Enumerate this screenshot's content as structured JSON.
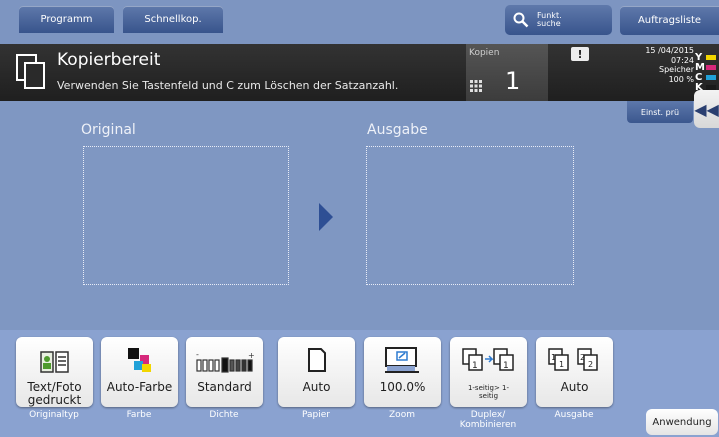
{
  "header": {
    "tab_programm": "Programm",
    "tab_schnellkop": "Schnellkop.",
    "funkt_suche_line1": "Funkt.",
    "funkt_suche_line2": "suche",
    "auftragsliste": "Auftragsliste"
  },
  "status": {
    "title": "Kopierbereit",
    "message": "Verwenden Sie Tastenfeld und C zum Löschen der Satzanzahl.",
    "copies_label": "Kopien",
    "copies_value": "1",
    "warning_symbol": "!",
    "date": "15 /04/2015",
    "time": "07:24",
    "memory_label": "Speicher",
    "memory_value": "100 %",
    "toner_levels": [
      {
        "letter": "Y",
        "color": "#f2d600"
      },
      {
        "letter": "M",
        "color": "#d6287b"
      },
      {
        "letter": "C",
        "color": "#21a1d8"
      },
      {
        "letter": "K",
        "color": "#1a1a1a"
      }
    ],
    "einst_pru": "Einst. prü"
  },
  "preview": {
    "original_label": "Original",
    "ausgabe_label": "Ausgabe"
  },
  "functions": [
    {
      "value": "Text/Foto gedruckt",
      "caption": "Originaltyp",
      "icon": "text-photo-icon"
    },
    {
      "value": "Auto-Farbe",
      "caption": "Farbe",
      "icon": "color-squares-icon"
    },
    {
      "value": "Standard",
      "caption": "Dichte",
      "icon": "density-slider-icon"
    },
    {
      "value": "Auto",
      "caption": "Papier",
      "icon": "paper-icon"
    },
    {
      "value": "100.0%",
      "caption": "Zoom",
      "icon": "zoom-icon"
    },
    {
      "value": "1-seitig> 1-seitig",
      "caption": "Duplex/ Kombinieren",
      "icon": "duplex-icon"
    },
    {
      "value": "Auto",
      "caption": "Ausgabe",
      "icon": "output-icon"
    }
  ],
  "anwendung": "Anwendung",
  "colors": {
    "accent": "#2e4f94",
    "background": "#7f97c2"
  }
}
